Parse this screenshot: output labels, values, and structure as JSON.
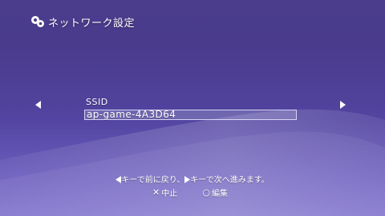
{
  "header": {
    "title": "ネットワーク設定",
    "icon": "network-settings-icon"
  },
  "navigation": {
    "left_icon": "arrow-left-icon",
    "right_icon": "arrow-right-icon"
  },
  "field": {
    "label": "SSID",
    "value": "ap-game-4A3D64"
  },
  "hint": {
    "part1": "キーで前に戻り、",
    "part2": "キーで次へ進みます。"
  },
  "actions": {
    "cancel": {
      "glyph": "✕",
      "label": "中止"
    },
    "edit": {
      "glyph": "○",
      "label": "編集"
    }
  },
  "colors": {
    "background_top": "#4b3c8c",
    "background_bottom": "#7d70cc",
    "text": "#ffffff"
  }
}
